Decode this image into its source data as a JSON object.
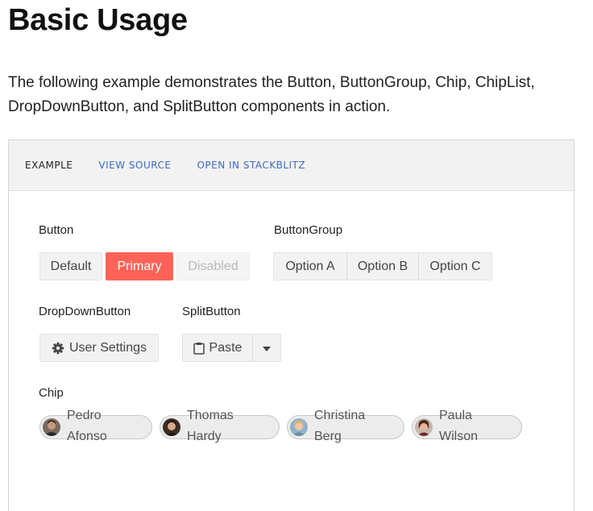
{
  "page": {
    "title": "Basic Usage",
    "intro": "The following example demonstrates the Button, ButtonGroup, Chip, ChipList, DropDownButton, and SplitButton components in action."
  },
  "tabs": [
    {
      "label": "EXAMPLE",
      "active": true
    },
    {
      "label": "VIEW SOURCE",
      "active": false
    },
    {
      "label": "OPEN IN STACKBLITZ",
      "active": false
    }
  ],
  "sections": {
    "button": {
      "label": "Button",
      "default_label": "Default",
      "primary_label": "Primary",
      "disabled_label": "Disabled"
    },
    "buttongroup": {
      "label": "ButtonGroup",
      "options": [
        "Option A",
        "Option B",
        "Option C"
      ]
    },
    "dropdown": {
      "label": "DropDownButton",
      "button_label": "User Settings",
      "icon": "gear-icon"
    },
    "split": {
      "label": "SplitButton",
      "button_label": "Paste",
      "icon": "clipboard-icon",
      "arrow_icon": "caret-down-icon"
    },
    "chip": {
      "label": "Chip",
      "chips": [
        {
          "line1": "Pedro",
          "line2": "Afonso"
        },
        {
          "line1": "Thomas",
          "line2": "Hardy"
        },
        {
          "line1": "Christina",
          "line2": "Berg"
        },
        {
          "line1": "Paula",
          "line2": "Wilson"
        }
      ]
    }
  },
  "colors": {
    "primary": "#ff6358",
    "link": "#3e69c6"
  }
}
